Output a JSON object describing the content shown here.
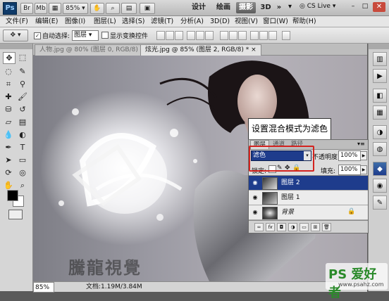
{
  "appbar": {
    "logo": "Ps",
    "zoom": "85%",
    "workspaces": [
      "设计",
      "绘画",
      "摄影",
      "3D"
    ],
    "active_workspace": "摄影",
    "more": "»",
    "cs_live": "CS Live"
  },
  "menu": [
    "文件(F)",
    "编辑(E)",
    "图像(I)",
    "图层(L)",
    "选择(S)",
    "滤镜(T)",
    "分析(A)",
    "3D(D)",
    "视图(V)",
    "窗口(W)",
    "帮助(H)"
  ],
  "options": {
    "auto_select_label": "自动选择:",
    "auto_select_value": "图层",
    "transform_label": "显示变换控件"
  },
  "doc_tabs": [
    {
      "label": "人物.jpg @ 80% (图层 0, RGB/8) *",
      "active": false
    },
    {
      "label": "炫光.jpg @ 85% (图层 2, RGB/8) *",
      "active": true
    }
  ],
  "status": {
    "zoom": "85%",
    "doc_info": "文档:1.19M/3.84M"
  },
  "callout": "设置混合模式为滤色",
  "layers_panel": {
    "tabs": [
      "图层",
      "通道",
      "路径"
    ],
    "blend_mode": "滤色",
    "opacity_label": "不透明度:",
    "opacity_value": "100%",
    "lock_label": "锁定:",
    "fill_label": "填充:",
    "fill_value": "100%",
    "layers": [
      {
        "name": "图层 2",
        "selected": true
      },
      {
        "name": "图层 1",
        "selected": false
      },
      {
        "name": "背景",
        "selected": false
      }
    ]
  },
  "watermark": "騰龍視覺",
  "footer_logo": {
    "brand": "PS 爱好者",
    "site": "www.psahz.com"
  },
  "colors": {
    "accent_select": "#1e3c8c",
    "callout_border": "#d3231f",
    "fg_swatch": "#000000",
    "bg_swatch": "#ffffff"
  }
}
